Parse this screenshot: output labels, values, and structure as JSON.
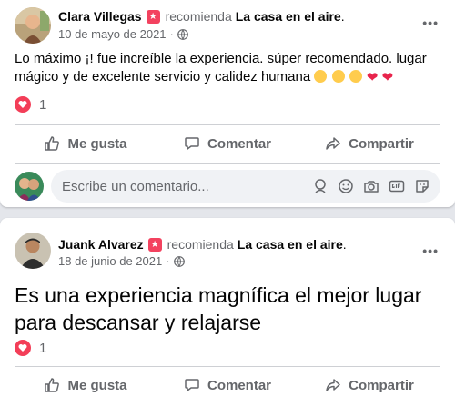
{
  "posts": [
    {
      "author": "Clara Villegas",
      "verb": "recomienda",
      "page": "La casa en el aire",
      "date": "10 de mayo de 2021",
      "text": "Lo máximo ¡! fue increíble la experiencia.  súper recomendado.  lugar mágico y de excelente servicio y calidez humana",
      "emoji_trail": [
        "kiss-emoji",
        "kiss-emoji",
        "kiss-emoji",
        "heart-emoji",
        "heart-emoji"
      ],
      "reaction_count": "1"
    },
    {
      "author": "Juank Alvarez",
      "verb": "recomienda",
      "page": "La casa en el aire",
      "date": "18 de junio de 2021",
      "text": "Es una experiencia magnífica el mejor lugar para descansar y relajarse",
      "reaction_count": "1"
    }
  ],
  "actions": {
    "like": "Me gusta",
    "comment": "Comentar",
    "share": "Compartir"
  },
  "comment_box": {
    "placeholder": "Escribe un comentario..."
  },
  "separators": {
    "dot": ".",
    "middot": "·",
    "more": "•••"
  },
  "colors": {
    "accent_reaction": "#f33e58",
    "recommend_badge": "#f3425f",
    "secondary_text": "#65676b"
  }
}
